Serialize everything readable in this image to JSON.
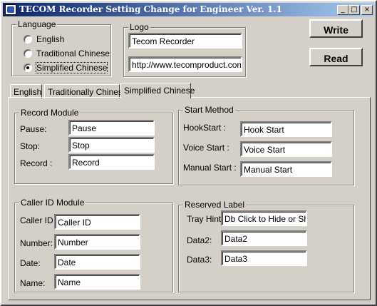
{
  "window": {
    "title": "TECOM Recorder Setting Change for Engineer Ver. 1.1",
    "controls": {
      "minimize": "_",
      "maximize": "□",
      "close": "×"
    }
  },
  "language": {
    "legend": "Language",
    "options": [
      "English",
      "Traditional Chinese",
      "Simplified Chinese"
    ],
    "selected": "Simplified Chinese"
  },
  "logo": {
    "legend": "Logo",
    "name_value": "Tecom Recorder",
    "url_value": "http://www.tecomproduct.com.tw"
  },
  "buttons": {
    "write": "Write",
    "read": "Read"
  },
  "tabs": [
    "English",
    "Traditionally Chinese",
    "Simplified Chinese"
  ],
  "active_tab": "Simplified Chinese",
  "record_module": {
    "legend": "Record  Module",
    "pause_label": "Pause:",
    "pause_value": "Pause",
    "stop_label": "Stop:",
    "stop_value": "Stop",
    "record_label": "Record :",
    "record_value": "Record"
  },
  "start_method": {
    "legend": "Start Method",
    "hook_label": "HookStart :",
    "hook_value": "Hook Start",
    "voice_label": "Voice Start :",
    "voice_value": "Voice Start",
    "manual_label": "Manual Start :",
    "manual_value": "Manual Start"
  },
  "caller_id_module": {
    "legend": "Caller ID Module",
    "callerid_label": "Caller ID :",
    "callerid_value": "Caller ID",
    "number_label": "Number:",
    "number_value": "Number",
    "date_label": "Date:",
    "date_value": "Date",
    "name_label": "Name:",
    "name_value": "Name"
  },
  "reserved_label": {
    "legend": "Reserved Label",
    "tray_label": "Tray Hint :",
    "tray_value": "Db Click to Hide or Show",
    "data2_label": "Data2:",
    "data2_value": "Data2",
    "data3_label": "Data3:",
    "data3_value": "Data3"
  }
}
